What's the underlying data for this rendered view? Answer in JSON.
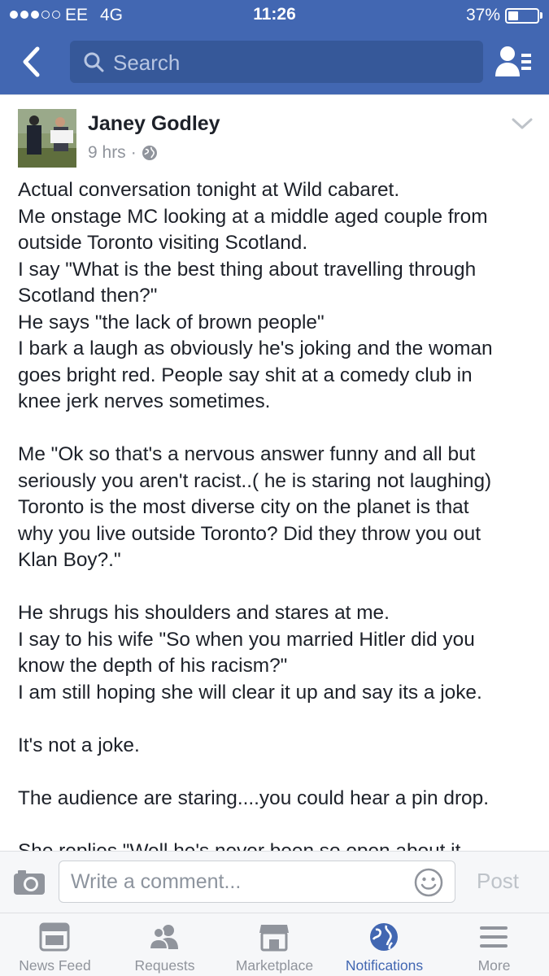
{
  "status_bar": {
    "carrier": "EE",
    "network": "4G",
    "time": "11:26",
    "battery": "37%",
    "battery_level": 0.37,
    "signal_bars_filled": 3,
    "signal_bars_total": 5
  },
  "header": {
    "search_placeholder": "Search",
    "brand_color": "#4267b2"
  },
  "post": {
    "author": "Janey Godley",
    "time_ago": "9 hrs",
    "separator": "·",
    "privacy_icon": "globe-icon",
    "avatar_sign_text": "TRUMP CUNT",
    "lines": [
      "Actual conversation tonight at Wild cabaret.",
      "Me onstage MC looking at a middle aged couple from",
      "outside Toronto visiting Scotland.",
      "I say \"What is the best thing about travelling through",
      "Scotland then?\"",
      "He says \"the lack of brown people\"",
      "I bark a laugh as obviously he's joking and the woman",
      "goes bright red. People say shit at a comedy club in",
      "knee jerk nerves sometimes.",
      "",
      "Me \"Ok so that's a nervous answer funny and all but",
      "seriously you aren't racist..( he is staring not laughing)",
      "Toronto is the most diverse city on the planet is that",
      "why you live outside Toronto? Did they throw you out",
      "Klan Boy?.\"",
      "",
      "He shrugs his shoulders and stares at me.",
      "I say to his wife \"So when you married Hitler did you",
      "know the depth of his racism?\"",
      "I am still hoping she will clear it up and say its a joke.",
      "",
      "It's not a joke.",
      "",
      "The audience are staring....you could hear a pin drop.",
      "",
      "She replies \"Well he's never been so open about it"
    ]
  },
  "comment_bar": {
    "placeholder": "Write a comment...",
    "post_label": "Post"
  },
  "tabs": [
    {
      "label": "News Feed",
      "icon": "news-feed-icon",
      "active": false
    },
    {
      "label": "Requests",
      "icon": "requests-icon",
      "active": false
    },
    {
      "label": "Marketplace",
      "icon": "marketplace-icon",
      "active": false
    },
    {
      "label": "Notifications",
      "icon": "globe-icon",
      "active": true
    },
    {
      "label": "More",
      "icon": "menu-icon",
      "active": false
    }
  ]
}
